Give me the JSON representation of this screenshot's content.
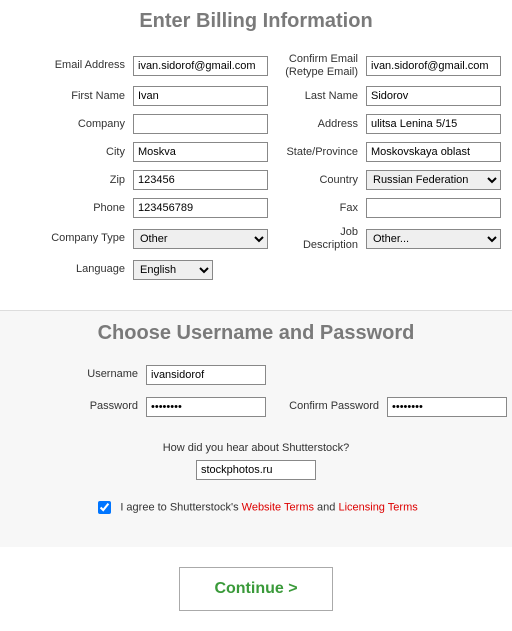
{
  "billing": {
    "title": "Enter Billing Information",
    "labels": {
      "email": "Email Address",
      "confirm_email": "Confirm Email\n(Retype Email)",
      "first_name": "First Name",
      "last_name": "Last Name",
      "company": "Company",
      "address": "Address",
      "city": "City",
      "state": "State/Province",
      "zip": "Zip",
      "country": "Country",
      "phone": "Phone",
      "fax": "Fax",
      "company_type": "Company Type",
      "job": "Job\nDescription",
      "language": "Language"
    },
    "values": {
      "email": "ivan.sidorof@gmail.com",
      "confirm_email": "ivan.sidorof@gmail.com",
      "first_name": "Ivan",
      "last_name": "Sidorov",
      "company": "",
      "address": "ulitsa Lenina 5/15",
      "city": "Moskva",
      "state": "Moskovskaya oblast",
      "zip": "123456",
      "country": "Russian Federation",
      "phone": "123456789",
      "fax": "",
      "company_type": "Other",
      "job": "Other...",
      "language": "English"
    }
  },
  "credentials": {
    "title": "Choose Username and Password",
    "labels": {
      "username": "Username",
      "password": "Password",
      "confirm_password": "Confirm Password"
    },
    "values": {
      "username": "ivansidorof",
      "password": "xxxxxxxx",
      "confirm_password": "xxxxxxxx"
    },
    "hear_question": "How did you hear about Shutterstock?",
    "hear_value": "stockphotos.ru",
    "agree_prefix": "I agree to Shutterstock's ",
    "agree_link1": "Website Terms",
    "agree_and": " and ",
    "agree_link2": "Licensing Terms",
    "agree_checked": true
  },
  "continue_label": "Continue >"
}
